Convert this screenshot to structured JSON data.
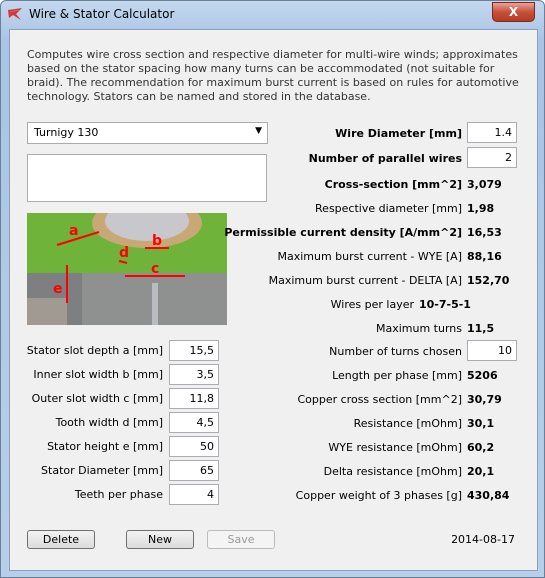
{
  "window": {
    "title": "Wire & Stator Calculator",
    "close_label": "X"
  },
  "description": "Computes wire cross section and respective diameter for multi-wire winds; approximates based on the stator spacing how many turns can be accommodated (not suitable for braid). The recommendation for maximum burst current is based on rules for automotive technology. Stators can be named and stored in the database.",
  "stator_select": {
    "value": "Turnigy 130"
  },
  "notes": {
    "value": ""
  },
  "diagram_labels": [
    "a",
    "b",
    "c",
    "d",
    "e"
  ],
  "stator_fields": [
    {
      "label": "Stator slot depth a [mm]",
      "value": "15,5"
    },
    {
      "label": "Inner slot width b [mm]",
      "value": "3,5"
    },
    {
      "label": "Outer slot width c [mm]",
      "value": "11,8"
    },
    {
      "label": "Tooth width d [mm]",
      "value": "4,5"
    },
    {
      "label": "Stator height e [mm]",
      "value": "50"
    },
    {
      "label": "Stator Diameter [mm]",
      "value": "65"
    },
    {
      "label": "Teeth per phase",
      "value": "4"
    }
  ],
  "wire_inputs": [
    {
      "label": "Wire Diameter [mm]",
      "value": "1.4"
    },
    {
      "label": "Number of parallel wires",
      "value": "2"
    }
  ],
  "results_top": [
    {
      "label": "Cross-section [mm^2]",
      "value": "3,079",
      "bold": true
    },
    {
      "label": "Respective diameter [mm]",
      "value": "1,98"
    },
    {
      "label": "Permissible current density [A/mm^2]",
      "value": "16,53",
      "bold": true
    },
    {
      "label": "Maximum burst current - WYE [A]",
      "value": "88,16"
    },
    {
      "label": "Maximum burst current - DELTA [A]",
      "value": "152,70"
    },
    {
      "label": "Wires per layer",
      "value": "10-7-5-1"
    },
    {
      "label": "Maximum turns",
      "value": "11,5"
    }
  ],
  "turns_chosen": {
    "label": "Number of turns chosen",
    "value": "10"
  },
  "results_bottom": [
    {
      "label": "Length per phase [mm]",
      "value": "5206"
    },
    {
      "label": "Copper cross section [mm^2]",
      "value": "30,79"
    },
    {
      "label": "Resistance [mOhm]",
      "value": "30,1"
    },
    {
      "label": "WYE resistance [mOhm]",
      "value": "60,2"
    },
    {
      "label": "Delta resistance [mOhm]",
      "value": "20,1"
    },
    {
      "label": "Copper weight of 3 phases [g]",
      "value": "430,84"
    }
  ],
  "buttons": {
    "delete": "Delete",
    "new": "New",
    "save": "Save"
  },
  "date": "2014-08-17"
}
